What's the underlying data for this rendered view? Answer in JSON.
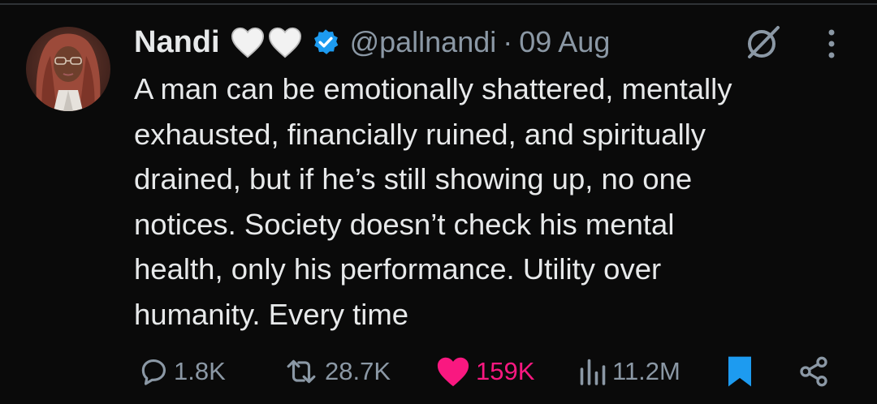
{
  "tweet": {
    "author_name": "Nandi",
    "handle": "@pallnandi",
    "separator": "·",
    "date": "09 Aug",
    "text": "A man can be emotionally shattered, mentally\nexhausted, financially ruined, and spiritually\ndrained, but if he’s still showing up, no one\nnotices. Society doesn’t check his mental\nhealth, only his performance. Utility over\nhumanity. Every time"
  },
  "badges": {
    "name_emojis": [
      "white-heart-icon",
      "white-heart-icon"
    ],
    "verified": "verified-badge-icon"
  },
  "actions": {
    "replies": "1.8K",
    "reposts": "28.7K",
    "likes": "159K",
    "views": "11.2M"
  },
  "colors": {
    "background": "#0a0a0a",
    "text": "#e7e9ea",
    "muted": "#8b98a5",
    "like": "#f91880",
    "verified": "#1d9bf0",
    "bookmark": "#1d9bf0"
  }
}
